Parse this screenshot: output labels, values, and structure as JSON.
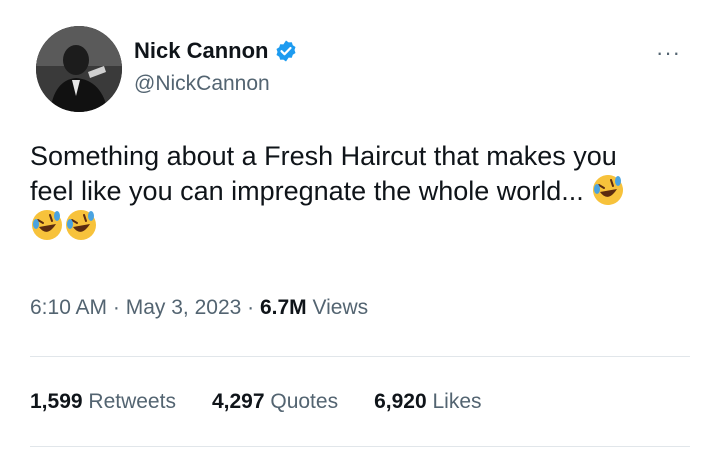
{
  "tweet": {
    "author": {
      "display_name": "Nick Cannon",
      "handle": "@NickCannon",
      "verified_icon": "verified-badge-icon"
    },
    "more_icon": "more-options-icon",
    "text_line1": "Something about a Fresh Haircut that makes you",
    "text_line2": "feel like you can impregnate the whole world...",
    "emoji": "rolling-on-floor-laughing-emoji",
    "emoji_count": 3,
    "meta": {
      "time": "6:10 AM",
      "date": "May 3, 2023",
      "separator": " · ",
      "views_count": "6.7M",
      "views_label": "Views"
    },
    "stats": {
      "retweets_count": "1,599",
      "retweets_label": "Retweets",
      "quotes_count": "4,297",
      "quotes_label": "Quotes",
      "likes_count": "6,920",
      "likes_label": "Likes"
    }
  },
  "colors": {
    "primary_text": "#0f1419",
    "secondary_text": "#536471",
    "verified_blue": "#1d9bf0",
    "divider": "#e1e6ea"
  }
}
